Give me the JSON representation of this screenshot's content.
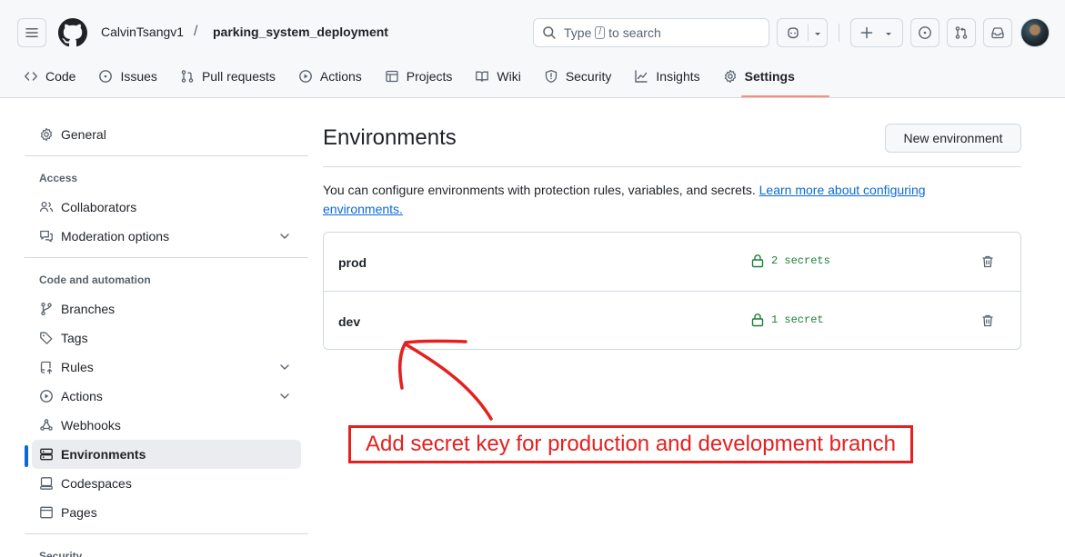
{
  "header": {
    "owner": "CalvinTsangv1",
    "separator": "/",
    "repo": "parking_system_deployment",
    "search_prefix": "Type",
    "search_key": "/",
    "search_suffix": "to search"
  },
  "icons": {
    "hamburger": "three-bars-icon",
    "logo": "github-mark-icon",
    "search": "search-icon",
    "copilot": "copilot-icon",
    "plus": "plus-icon",
    "issues": "issue-opened-icon",
    "pulls": "git-pull-request-icon",
    "inbox": "inbox-icon",
    "trash": "trash-icon",
    "lock": "lock-icon"
  },
  "tabs": [
    {
      "label": "Code",
      "icon": "code-icon"
    },
    {
      "label": "Issues",
      "icon": "issue-opened-icon"
    },
    {
      "label": "Pull requests",
      "icon": "git-pull-request-icon"
    },
    {
      "label": "Actions",
      "icon": "play-icon"
    },
    {
      "label": "Projects",
      "icon": "table-icon"
    },
    {
      "label": "Wiki",
      "icon": "book-icon"
    },
    {
      "label": "Security",
      "icon": "shield-icon"
    },
    {
      "label": "Insights",
      "icon": "graph-icon"
    },
    {
      "label": "Settings",
      "icon": "gear-icon",
      "active": true
    }
  ],
  "sidebar": {
    "general": "General",
    "access_heading": "Access",
    "collaborators": "Collaborators",
    "moderation": "Moderation options",
    "code_heading": "Code and automation",
    "branches": "Branches",
    "tags": "Tags",
    "rules": "Rules",
    "actions": "Actions",
    "webhooks": "Webhooks",
    "environments": "Environments",
    "codespaces": "Codespaces",
    "pages": "Pages",
    "security_heading": "Security"
  },
  "main": {
    "title": "Environments",
    "new_button": "New environment",
    "description": "You can configure environments with protection rules, variables, and secrets.",
    "learn_more": "Learn more about configuring environments.",
    "environments": [
      {
        "name": "prod",
        "secrets": "2 secrets"
      },
      {
        "name": "dev",
        "secrets": "1 secret"
      }
    ]
  },
  "annotation": {
    "text": "Add secret key for production and development branch",
    "color": "#e5201f"
  },
  "colors": {
    "accent": "#0969da",
    "tab_underline": "#fd8c73",
    "secret_green": "#1a7f37",
    "border": "#d1d9e0"
  }
}
